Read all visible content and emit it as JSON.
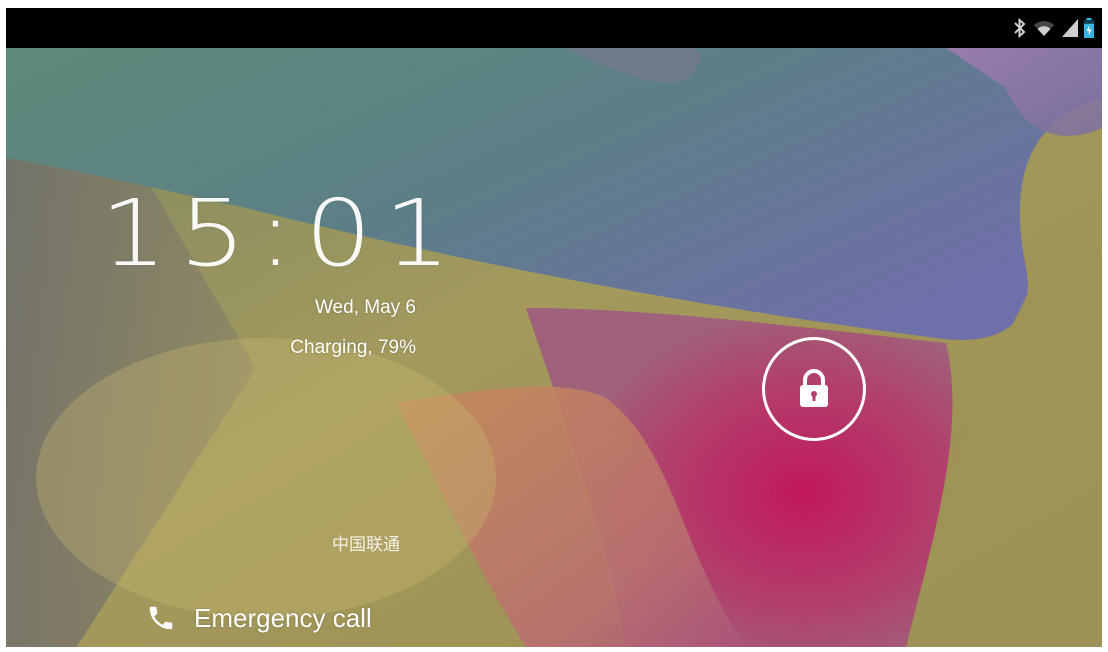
{
  "status_bar": {
    "icons": [
      "bluetooth-icon",
      "wifi-icon",
      "signal-icon",
      "battery-charging-icon"
    ],
    "battery_level": 0.79
  },
  "lockscreen": {
    "time": "15:01",
    "date": "Wed, May 6",
    "charging_status": "Charging, 79%",
    "carrier": "中国联通",
    "emergency_call_label": "Emergency call",
    "unlock_icon": "lock-icon"
  },
  "colors": {
    "status_bar_bg": "#000000",
    "text": "#ffffff",
    "accent_magenta": "#c2185b"
  }
}
